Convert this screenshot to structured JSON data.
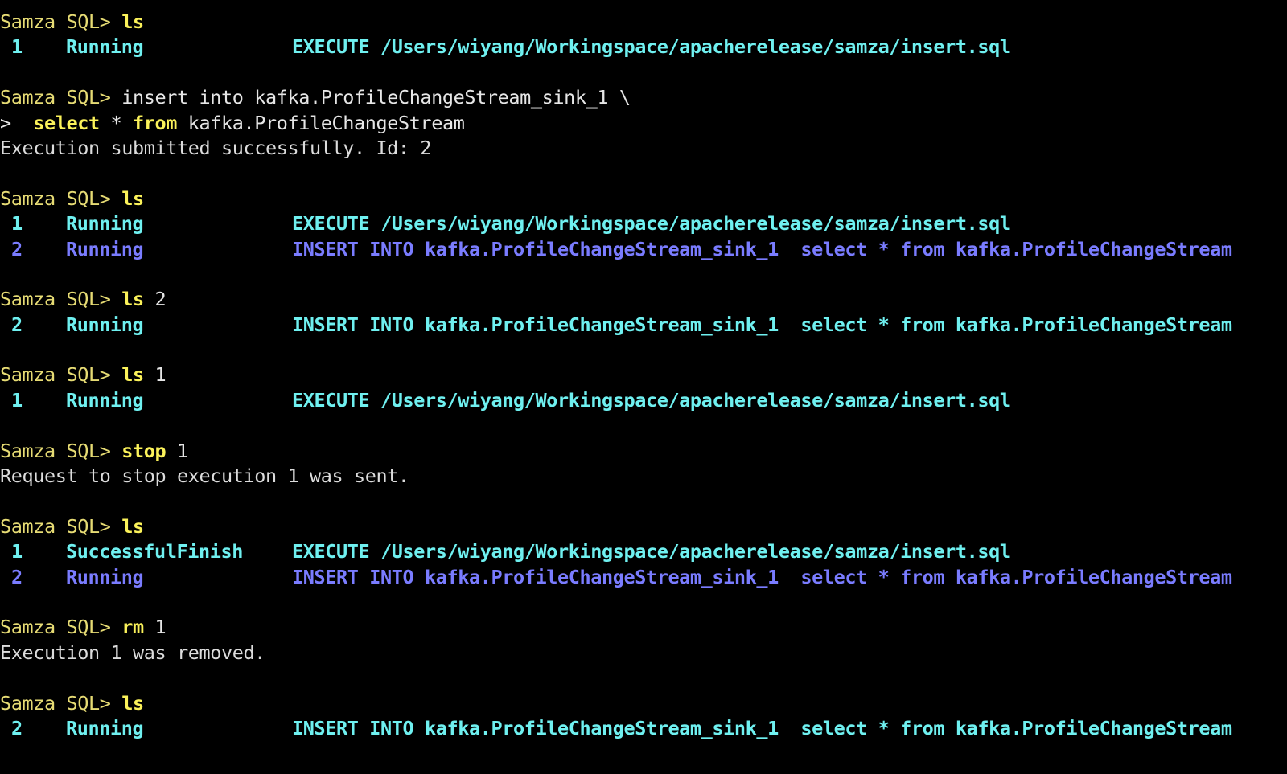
{
  "prompt": "Samza SQL>",
  "colors": {
    "background": "#000000",
    "prompt": "#e6db74",
    "command": "#fbf25a",
    "plain_text": "#dcdcdc",
    "row_cyan": "#6ff0f0",
    "row_blue": "#7a7cff"
  },
  "session": {
    "block1": {
      "cmd": "ls",
      "rows": [
        {
          "id": "1",
          "status": "Running",
          "query": "EXECUTE /Users/wiyang/Workingspace/apacherelease/samza/insert.sql"
        }
      ]
    },
    "block2": {
      "cmd_text": "insert into kafka.ProfileChangeStream_sink_1 \\",
      "continuation_marker": ">",
      "cont_select": "select",
      "cont_star": "*",
      "cont_from": "from",
      "cont_table": "kafka.ProfileChangeStream",
      "output": "Execution submitted successfully. Id: 2"
    },
    "block3": {
      "cmd": "ls",
      "rows": [
        {
          "id": "1",
          "status": "Running",
          "query": "EXECUTE /Users/wiyang/Workingspace/apacherelease/samza/insert.sql"
        },
        {
          "id": "2",
          "status": "Running",
          "query": "INSERT INTO kafka.ProfileChangeStream_sink_1  select * from kafka.ProfileChangeStream"
        }
      ]
    },
    "block4": {
      "cmd": "ls",
      "arg": "2",
      "rows": [
        {
          "id": "2",
          "status": "Running",
          "query": "INSERT INTO kafka.ProfileChangeStream_sink_1  select * from kafka.ProfileChangeStream"
        }
      ]
    },
    "block5": {
      "cmd": "ls",
      "arg": "1",
      "rows": [
        {
          "id": "1",
          "status": "Running",
          "query": "EXECUTE /Users/wiyang/Workingspace/apacherelease/samza/insert.sql"
        }
      ]
    },
    "block6": {
      "cmd": "stop",
      "arg": "1",
      "output": "Request to stop execution 1 was sent."
    },
    "block7": {
      "cmd": "ls",
      "rows": [
        {
          "id": "1",
          "status": "SuccessfulFinish",
          "query": "EXECUTE /Users/wiyang/Workingspace/apacherelease/samza/insert.sql"
        },
        {
          "id": "2",
          "status": "Running",
          "query": "INSERT INTO kafka.ProfileChangeStream_sink_1  select * from kafka.ProfileChangeStream"
        }
      ]
    },
    "block8": {
      "cmd": "rm",
      "arg": "1",
      "output": "Execution 1 was removed."
    },
    "block9": {
      "cmd": "ls",
      "rows": [
        {
          "id": "2",
          "status": "Running",
          "query": "INSERT INTO kafka.ProfileChangeStream_sink_1  select * from kafka.ProfileChangeStream"
        }
      ]
    }
  }
}
